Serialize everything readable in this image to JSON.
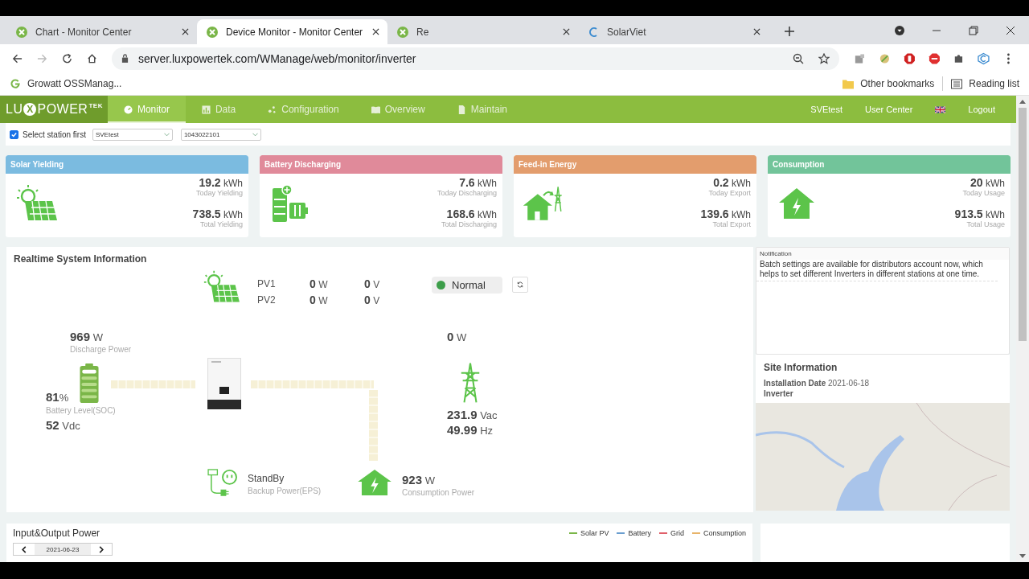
{
  "browser": {
    "tabs": [
      {
        "title": "Chart - Monitor Center",
        "selected": false,
        "kind": "lux"
      },
      {
        "title": "Device Monitor - Monitor Center",
        "selected": true,
        "kind": "lux"
      },
      {
        "title": "Re",
        "selected": false,
        "kind": "lux"
      },
      {
        "title": "SolarViet",
        "selected": false,
        "kind": "web"
      }
    ],
    "url": "server.luxpowertek.com/WManage/web/monitor/inverter",
    "bookmarks": [
      {
        "label": "Growatt OSSManag..."
      }
    ],
    "other_bookmarks": "Other bookmarks",
    "reading_list": "Reading list"
  },
  "nav": {
    "logo": {
      "pre": "LU",
      "mark": "X",
      "post": "POWER",
      "tm": "TEK"
    },
    "items": [
      {
        "label": "Monitor",
        "selected": true,
        "kind": "monitor"
      },
      {
        "label": "Data",
        "selected": false,
        "kind": "data"
      },
      {
        "label": "Configuration",
        "selected": false,
        "kind": "config"
      },
      {
        "label": "Overview",
        "selected": false,
        "kind": "overview"
      },
      {
        "label": "Maintain",
        "selected": false,
        "kind": "maintain"
      }
    ],
    "user": "SVEtest",
    "user_center": "User Center",
    "logout": "Logout"
  },
  "filters": {
    "select_station": {
      "label": "Select station first",
      "checked": true
    },
    "station": "SVEtest",
    "device": "1043022101"
  },
  "cards": [
    {
      "title": "Solar Yielding",
      "color": "#7bbbe0",
      "kind": "solar",
      "today": "19.2",
      "today_unit": "kWh",
      "today_label": "Today Yielding",
      "total": "738.5",
      "total_unit": "kWh",
      "total_label": "Total Yielding"
    },
    {
      "title": "Battery Discharging",
      "color": "#e08a9a",
      "kind": "battery",
      "today": "7.6",
      "today_unit": "kWh",
      "today_label": "Today Discharging",
      "total": "168.6",
      "total_unit": "kWh",
      "total_label": "Total Discharging"
    },
    {
      "title": "Feed-in Energy",
      "color": "#e39d6d",
      "kind": "export",
      "today": "0.2",
      "today_unit": "kWh",
      "today_label": "Today Export",
      "total": "139.6",
      "total_unit": "kWh",
      "total_label": "Total Export"
    },
    {
      "title": "Consumption",
      "color": "#72c49a",
      "kind": "consumption",
      "today": "20",
      "today_unit": "kWh",
      "today_label": "Today Usage",
      "total": "913.5",
      "total_unit": "kWh",
      "total_label": "Total Usage"
    }
  ],
  "realtime": {
    "title": "Realtime System Information",
    "pv": [
      {
        "label": "PV1",
        "power": "0",
        "power_unit": "W",
        "voltage": "0",
        "voltage_unit": "V"
      },
      {
        "label": "PV2",
        "power": "0",
        "power_unit": "W",
        "voltage": "0",
        "voltage_unit": "V"
      }
    ],
    "status": "Normal",
    "battery": {
      "power": "969",
      "power_unit": "W",
      "power_label": "Discharge Power",
      "soc": "81",
      "soc_unit": "%",
      "soc_label": "Battery Level(SOC)",
      "voltage": "52",
      "voltage_unit": "Vdc"
    },
    "grid": {
      "power": "0",
      "power_unit": "W",
      "voltage": "231.9",
      "voltage_unit": "Vac",
      "frequency": "49.99",
      "frequency_unit": "Hz"
    },
    "eps": {
      "status": "StandBy",
      "label": "Backup Power(EPS)"
    },
    "consumption": {
      "power": "923",
      "power_unit": "W",
      "label": "Consumption Power"
    }
  },
  "notification": {
    "title": "Notification",
    "text": "Batch settings are available for distributors account now, which helps to set different Inverters in different stations at one time."
  },
  "site": {
    "title": "Site Information",
    "install_label": "Installation Date",
    "install_date": "2021-06-18",
    "inverter_label": "Inverter"
  },
  "io_power": {
    "title": "Input&Output Power",
    "date": "2021-06-23",
    "legend": [
      {
        "label": "Solar PV",
        "color": "#7ab648"
      },
      {
        "label": "Battery",
        "color": "#6a9ecf"
      },
      {
        "label": "Grid",
        "color": "#e0606a"
      },
      {
        "label": "Consumption",
        "color": "#e8b46a"
      }
    ]
  }
}
